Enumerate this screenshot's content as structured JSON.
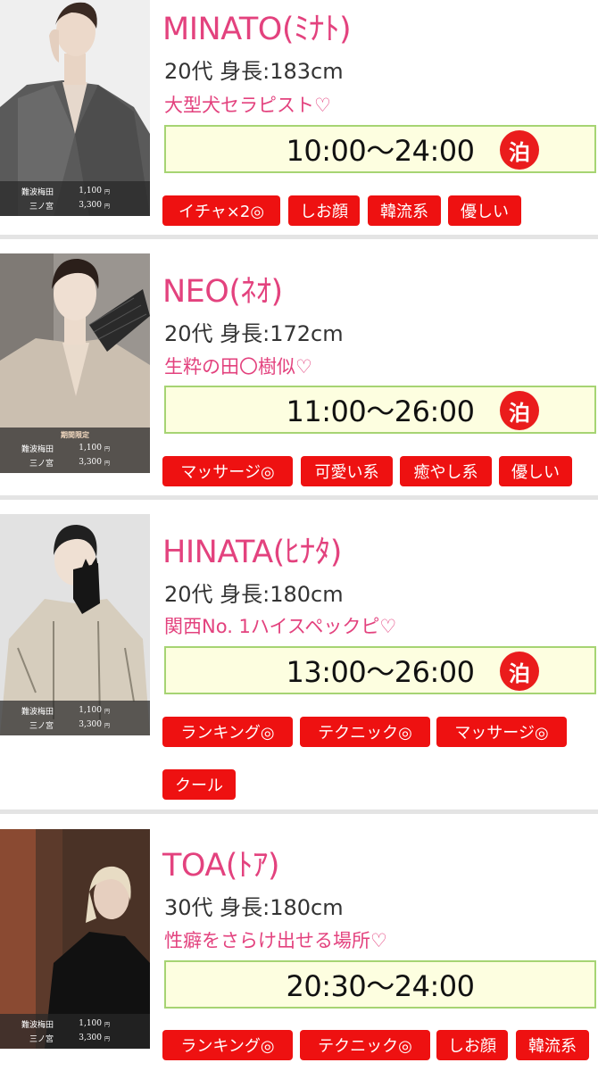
{
  "cards": [
    {
      "name": "MINATO(ﾐﾅﾄ)",
      "age_height": "20代 身長:183cm",
      "catch": "大型犬セラピスト♡",
      "hours": "10:00〜24:00",
      "stay_badge": "泊",
      "tags": [
        "イチャ×2◎",
        "しお顔",
        "韓流系",
        "優しい"
      ],
      "price_limited": "",
      "prices": [
        {
          "area": "難波梅田",
          "value": "1,100",
          "unit": "円"
        },
        {
          "area": "三ノ宮",
          "value": "3,300",
          "unit": "円"
        }
      ]
    },
    {
      "name": "NEO(ﾈｵ)",
      "age_height": "20代 身長:172cm",
      "catch": "生粋の田〇樹似♡",
      "hours": "11:00〜26:00",
      "stay_badge": "泊",
      "tags": [
        "マッサージ◎",
        "可愛い系",
        "癒やし系",
        "優しい"
      ],
      "price_limited": "期間限定",
      "prices": [
        {
          "area": "難波梅田",
          "value": "1,100",
          "unit": "円"
        },
        {
          "area": "三ノ宮",
          "value": "3,300",
          "unit": "円"
        }
      ]
    },
    {
      "name": "HINATA(ﾋﾅﾀ)",
      "age_height": "20代 身長:180cm",
      "catch": "関西No. 1ハイスペックピ♡",
      "hours": "13:00〜26:00",
      "stay_badge": "泊",
      "tags": [
        "ランキング◎",
        "テクニック◎",
        "マッサージ◎",
        "クール"
      ],
      "price_limited": "",
      "prices": [
        {
          "area": "難波梅田",
          "value": "1,100",
          "unit": "円"
        },
        {
          "area": "三ノ宮",
          "value": "3,300",
          "unit": "円"
        }
      ]
    },
    {
      "name": "TOA(ﾄｱ)",
      "age_height": "30代 身長:180cm",
      "catch": "性癖をさらけ出せる場所♡",
      "hours": "20:30〜24:00",
      "stay_badge": "",
      "tags": [
        "ランキング◎",
        "テクニック◎",
        "しお顔",
        "韓流系"
      ],
      "price_limited": "",
      "prices": [
        {
          "area": "難波梅田",
          "value": "1,100",
          "unit": "円"
        },
        {
          "area": "三ノ宮",
          "value": "3,300",
          "unit": "円"
        }
      ]
    }
  ]
}
